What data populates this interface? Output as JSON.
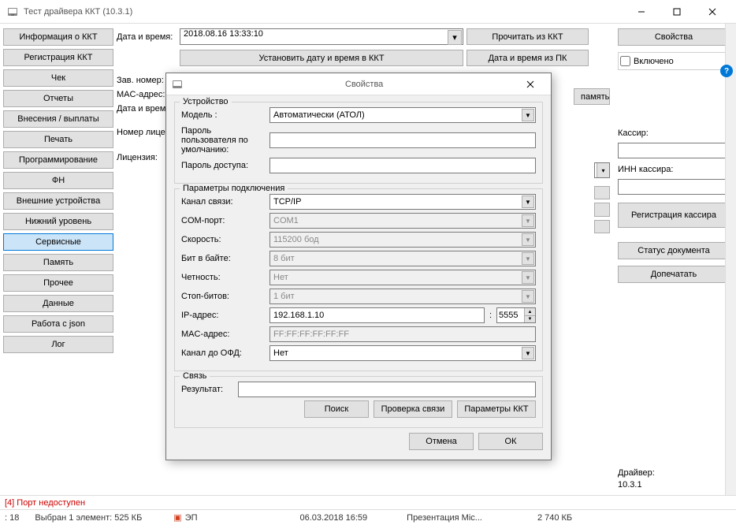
{
  "window": {
    "title": "Тест драйвера ККТ (10.3.1)"
  },
  "sidebar": {
    "items": [
      "Информация о ККТ",
      "Регистрация ККТ",
      "Чек",
      "Отчеты",
      "Внесения / выплаты",
      "Печать",
      "Программирование",
      "ФН",
      "Внешние устройства",
      "Нижний уровень",
      "Сервисные",
      "Память",
      "Прочее",
      "Данные",
      "Работа с json",
      "Лог"
    ],
    "activeIndex": 10
  },
  "content": {
    "dateTimeLabel": "Дата и время:",
    "dateTimeValue": "2018.08.16 13:33:10",
    "readFromKKT": "Прочитать из ККТ",
    "setDateTime": "Установить дату и время в ККТ",
    "dateTimeFromPC": "Дата и время из ПК",
    "serialLabel": "Зав. номер:",
    "macLabel": "MAC-адрес:",
    "dateTimeLabel2": "Дата и время:",
    "licenseNumLabel": "Номер лицензи",
    "licenseLabel": "Лицензия:",
    "memoryBtn": "память"
  },
  "right": {
    "propertiesBtn": "Свойства",
    "enabledLabel": "Включено",
    "cashierLabel": "Кассир:",
    "cashierValue": "",
    "cashierInnLabel": "ИНН кассира:",
    "cashierInnValue": "",
    "regCashier": "Регистрация кассира",
    "docStatus": "Статус документа",
    "reprint": "Допечатать",
    "driverLabel": "Драйвер:",
    "driverVersion": "10.3.1"
  },
  "status": {
    "text": "[4] Порт недоступен"
  },
  "explorer": {
    "col1": ": 18",
    "col2": "Выбран 1 элемент: 525 КБ",
    "item": "ЭП",
    "date": "06.03.2018 16:59",
    "desc": "Презентация Mic...",
    "size": "2 740 КБ"
  },
  "dialog": {
    "title": "Свойства",
    "deviceLegend": "Устройство",
    "modelLabel": "Модель :",
    "modelValue": "Автоматически (АТОЛ)",
    "userPassLabel": "Пароль пользователя по умолчанию:",
    "userPassValue": "",
    "accessPassLabel": "Пароль доступа:",
    "accessPassValue": "",
    "connLegend": "Параметры подключения",
    "channelLabel": "Канал связи:",
    "channelValue": "TCP/IP",
    "comLabel": "COM-порт:",
    "comValue": "COM1",
    "speedLabel": "Скорость:",
    "speedValue": "115200 бод",
    "bitsLabel": "Бит в байте:",
    "bitsValue": "8 бит",
    "parityLabel": "Четность:",
    "parityValue": "Нет",
    "stopBitsLabel": "Стоп-битов:",
    "stopBitsValue": "1 бит",
    "ipLabel": "IP-адрес:",
    "ipValue": "192.168.1.10",
    "portValue": "5555",
    "macLabel": "MAC-адрес:",
    "macValue": "FF:FF:FF:FF:FF:FF",
    "ofdLabel": "Канал до ОФД:",
    "ofdValue": "Нет",
    "linkLegend": "Связь",
    "resultLabel": "Результат:",
    "resultValue": "",
    "searchBtn": "Поиск",
    "checkBtn": "Проверка связи",
    "kktParamsBtn": "Параметры ККТ",
    "cancelBtn": "Отмена",
    "okBtn": "ОК"
  }
}
